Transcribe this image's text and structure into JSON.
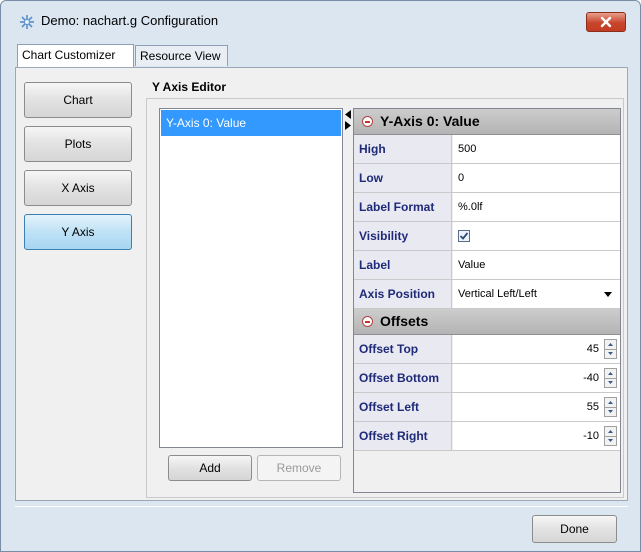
{
  "window": {
    "title": "Demo: nachart.g Configuration"
  },
  "tabs": [
    {
      "label": "Chart Customizer",
      "active": true
    },
    {
      "label": "Resource View",
      "active": false
    }
  ],
  "nav": [
    {
      "label": "Chart",
      "active": false
    },
    {
      "label": "Plots",
      "active": false
    },
    {
      "label": "X Axis",
      "active": false
    },
    {
      "label": "Y Axis",
      "active": true
    }
  ],
  "editor": {
    "title": "Y Axis Editor",
    "axis_list": [
      "Y-Axis 0: Value"
    ],
    "add_label": "Add",
    "remove_label": "Remove"
  },
  "properties": {
    "header": "Y-Axis 0: Value",
    "rows": [
      {
        "name": "High",
        "value": "500"
      },
      {
        "name": "Low",
        "value": "0"
      },
      {
        "name": "Label Format",
        "value": "%.0lf"
      },
      {
        "name": "Visibility",
        "value": ""
      },
      {
        "name": "Label",
        "value": "Value"
      },
      {
        "name": "Axis Position",
        "value": "Vertical Left/Left"
      }
    ],
    "visibility_checked": true,
    "offsets_header": "Offsets",
    "offsets": [
      {
        "name": "Offset Top",
        "value": "45"
      },
      {
        "name": "Offset Bottom",
        "value": "-40"
      },
      {
        "name": "Offset Left",
        "value": "55"
      },
      {
        "name": "Offset Right",
        "value": "-10"
      }
    ]
  },
  "footer": {
    "done_label": "Done"
  },
  "colors": {
    "selection": "#3399ff",
    "property_name": "#1f2a78",
    "close_button": "#c8452c"
  }
}
